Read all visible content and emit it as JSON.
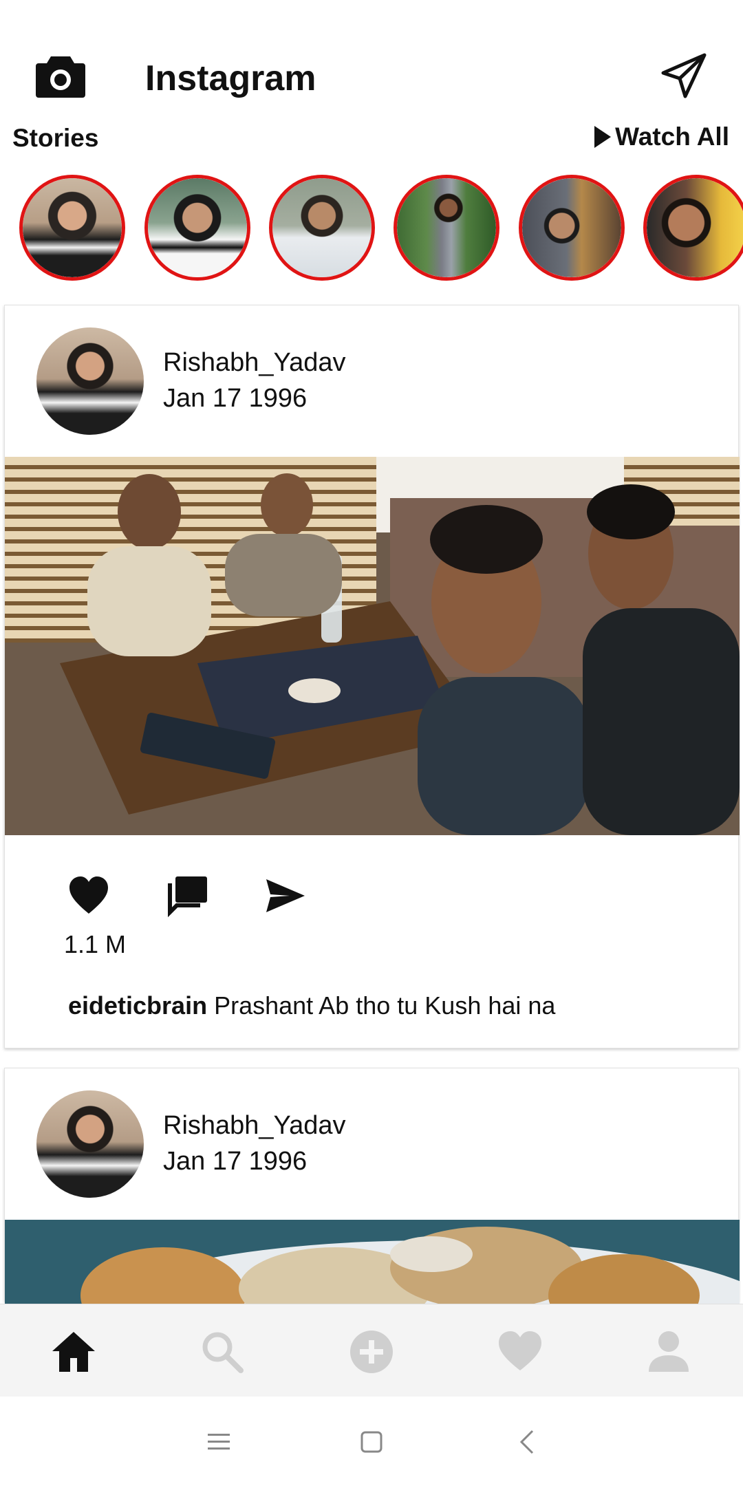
{
  "header": {
    "title": "Instagram",
    "camera_icon": "camera-icon",
    "direct_icon": "paper-plane-icon"
  },
  "stories": {
    "label": "Stories",
    "watch_all": "Watch All",
    "items": [
      {
        "ring_color": "#e01414"
      },
      {
        "ring_color": "#e01414"
      },
      {
        "ring_color": "#e01414"
      },
      {
        "ring_color": "#e01414"
      },
      {
        "ring_color": "#e01414"
      },
      {
        "ring_color": "#e01414"
      }
    ]
  },
  "posts": [
    {
      "username": "Rishabh_Yadav",
      "date": "Jan 17 1996",
      "likes": "1.1 M",
      "caption_user": "eideticbrain",
      "caption_text": "Prashant Ab tho tu Kush hai na"
    },
    {
      "username": "Rishabh_Yadav",
      "date": "Jan 17 1996"
    }
  ],
  "bottom_nav": {
    "items": [
      "home-icon",
      "search-icon",
      "add-icon",
      "heart-icon",
      "profile-icon"
    ],
    "active": "home-icon"
  },
  "system_nav": {
    "items": [
      "menu-icon",
      "home-square-icon",
      "back-icon"
    ]
  },
  "colors": {
    "story_ring": "#e01414",
    "nav_bg": "#f4f4f4",
    "inactive_icon": "#cfcfcf"
  }
}
